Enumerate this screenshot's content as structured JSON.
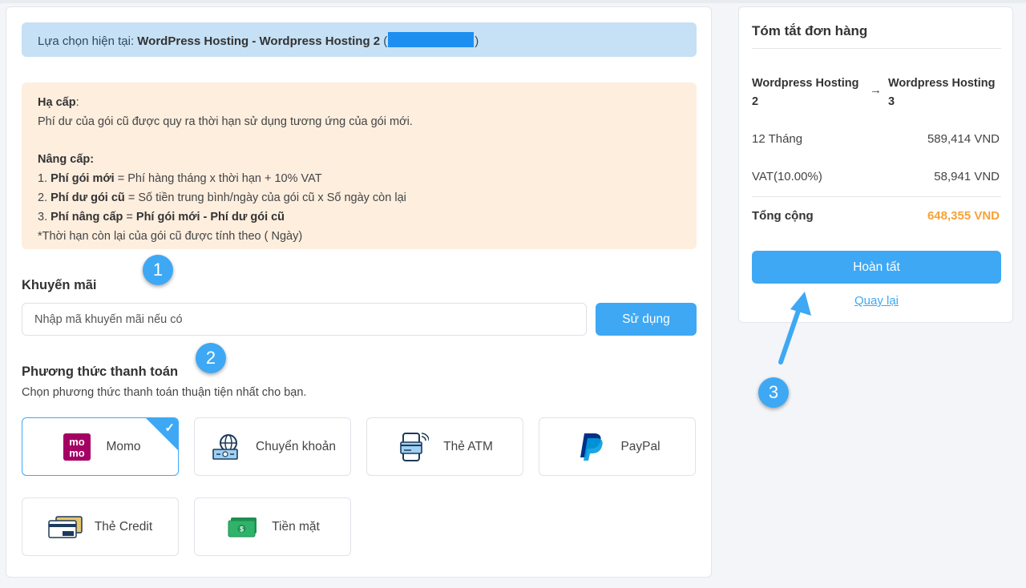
{
  "current_selection": {
    "prefix": "Lựa chọn hiện tại: ",
    "value": "WordPress Hosting - Wordpress Hosting 2",
    "paren_open": " (",
    "paren_close": ")"
  },
  "info": {
    "downgrade_title": "Hạ cấp",
    "colon": ":",
    "downgrade_text": "Phí dư của gói cũ được quy ra thời hạn sử dụng tương ứng của gói mới.",
    "upgrade_title": "Nâng cấp:",
    "line1_num": "1. ",
    "line1_bold": "Phí gói mới",
    "line1_rest": " = Phí hàng tháng x thời hạn + 10% VAT",
    "line2_num": "2. ",
    "line2_bold": "Phí dư gói cũ",
    "line2_rest": " = Số tiền trung bình/ngày của gói cũ x Số ngày còn lại",
    "line3_num": "3. ",
    "line3_bold1": "Phí nâng cấp",
    "line3_eq": " = ",
    "line3_bold2": "Phí gói mới - Phí dư gói cũ",
    "note": "*Thời hạn còn lại của gói cũ được tính theo ( Ngày)"
  },
  "promo": {
    "title": "Khuyến mãi",
    "placeholder": "Nhập mã khuyến mãi nếu có",
    "button": "Sử dụng"
  },
  "payment": {
    "title": "Phương thức thanh toán",
    "subtitle": "Chọn phương thức thanh toán thuận tiện nhất cho bạn.",
    "options": [
      {
        "label": "Momo",
        "icon": "momo-icon",
        "selected": true
      },
      {
        "label": "Chuyển khoản",
        "icon": "bank-transfer-icon",
        "selected": false
      },
      {
        "label": "Thẻ ATM",
        "icon": "atm-card-icon",
        "selected": false
      },
      {
        "label": "PayPal",
        "icon": "paypal-icon",
        "selected": false
      },
      {
        "label": "Thẻ Credit",
        "icon": "credit-card-icon",
        "selected": false
      },
      {
        "label": "Tiền mặt",
        "icon": "cash-icon",
        "selected": false
      }
    ],
    "momo_logo_top": "mo",
    "momo_logo_bottom": "mo",
    "check": "✓"
  },
  "summary": {
    "title": "Tóm tắt đơn hàng",
    "from_plan": "Wordpress Hosting 2",
    "arrow": "→",
    "to_plan": "Wordpress Hosting 3",
    "period_label": "12 Tháng",
    "period_value": "589,414 VND",
    "vat_label": "VAT(10.00%)",
    "vat_value": "58,941 VND",
    "total_label": "Tổng cộng",
    "total_value": "648,355 VND",
    "finish_button": "Hoàn tất",
    "back_link": "Quay lại"
  },
  "steps": [
    "1",
    "2",
    "3"
  ],
  "colors": {
    "accent": "#3ea8f4",
    "total": "#f7a236",
    "momo": "#a50064",
    "paypal_dark": "#003087",
    "paypal_light": "#009cde",
    "cash": "#2fb36a"
  }
}
